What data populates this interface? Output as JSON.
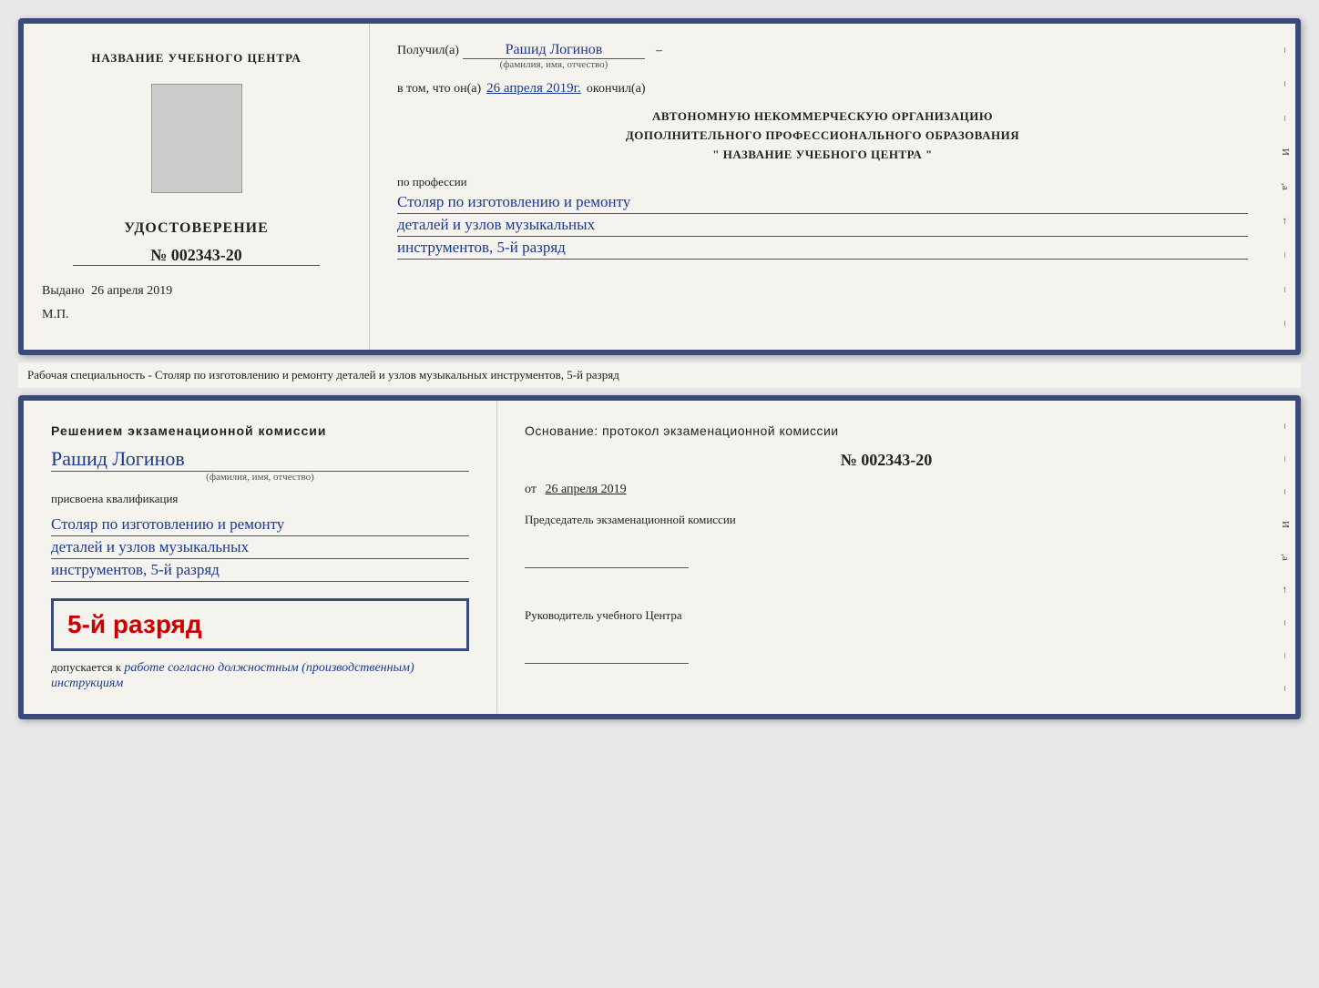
{
  "top_doc": {
    "left": {
      "school_name": "НАЗВАНИЕ УЧЕБНОГО ЦЕНТРА",
      "cert_label": "УДОСТОВЕРЕНИЕ",
      "cert_number": "№ 002343-20",
      "issued_label": "Выдано",
      "issued_date": "26 апреля 2019",
      "mp_label": "М.П."
    },
    "right": {
      "received_label": "Получил(а)",
      "person_name": "Рашид Логинов",
      "fio_note": "(фамилия, имя, отчество)",
      "dash": "–",
      "date_label": "в том, что он(а)",
      "date_value": "26 апреля 2019г.",
      "finished_label": "окончил(а)",
      "org_line1": "АВТОНОМНУЮ НЕКОММЕРЧЕСКУЮ ОРГАНИЗАЦИЮ",
      "org_line2": "ДОПОЛНИТЕЛЬНОГО ПРОФЕССИОНАЛЬНОГО ОБРАЗОВАНИЯ",
      "org_line3": "\"  НАЗВАНИЕ УЧЕБНОГО ЦЕНТРА  \"",
      "profession_label": "по профессии",
      "profession_line1": "Столяр по изготовлению и ремонту",
      "profession_line2": "деталей и узлов музыкальных",
      "profession_line3": "инструментов, 5-й разряд"
    }
  },
  "separator": {
    "text": "Рабочая специальность - Столяр по изготовлению и ремонту деталей и узлов музыкальных инструментов, 5-й разряд"
  },
  "bottom_doc": {
    "left": {
      "decision_text": "Решением экзаменационной комиссии",
      "person_name": "Рашид Логинов",
      "fio_note": "(фамилия, имя, отчество)",
      "qualification_label": "присвоена квалификация",
      "prof_line1": "Столяр по изготовлению и ремонту",
      "prof_line2": "деталей и узлов музыкальных",
      "prof_line3": "инструментов, 5-й разряд",
      "grade_text": "5-й разряд",
      "allow_label": "допускается к",
      "allow_text": "работе согласно должностным (производственным) инструкциям"
    },
    "right": {
      "basis_label": "Основание: протокол экзаменационной комиссии",
      "protocol_number": "№  002343-20",
      "date_prefix": "от",
      "date_value": "26 апреля 2019",
      "chairman_title": "Председатель экзаменационной комиссии",
      "head_title": "Руководитель учебного Центра"
    }
  },
  "edge_decorations": {
    "items": [
      "–",
      "–",
      "–",
      "И",
      ",а",
      "←",
      "–",
      "–",
      "–"
    ]
  }
}
